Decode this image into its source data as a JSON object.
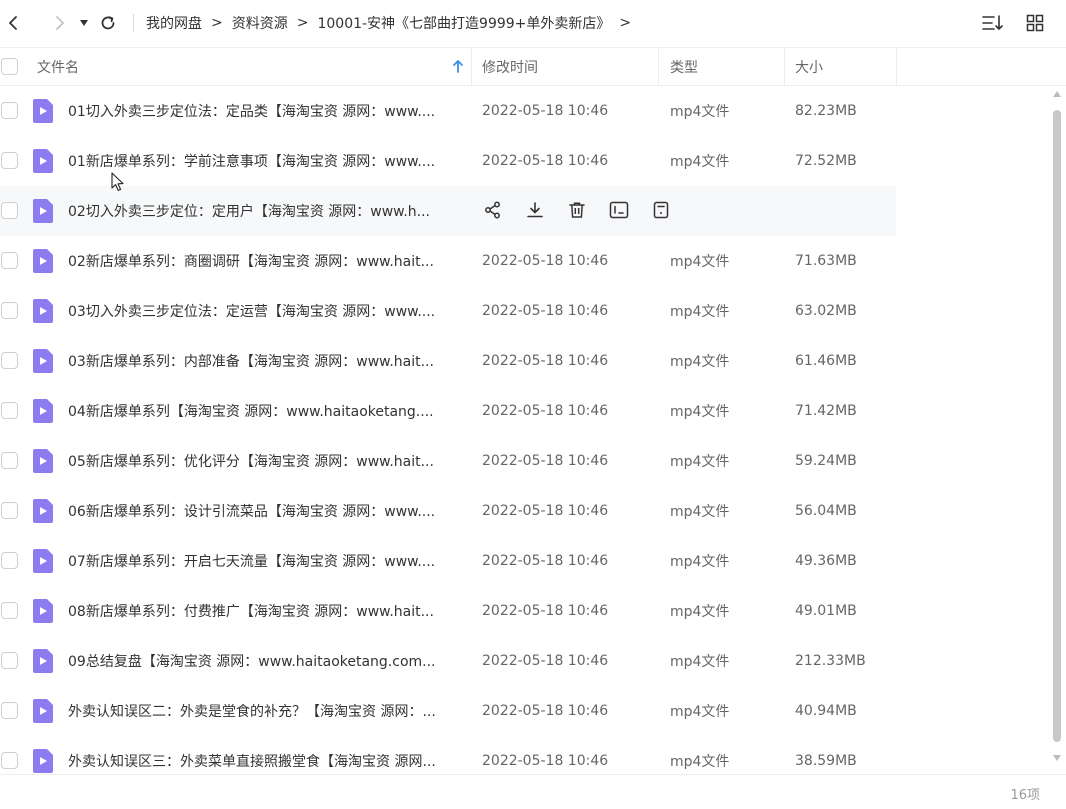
{
  "toolbar": {
    "breadcrumb": [
      "我的网盘",
      "资料资源",
      "10001-安神《七部曲打造9999+单外卖新店》"
    ],
    "separator": ">",
    "icons": {
      "back": "chevron-left-icon",
      "forward": "chevron-right-icon",
      "dropdown": "triangle-down-icon",
      "refresh": "refresh-icon",
      "sort": "sort-list-icon",
      "grid": "grid-view-icon"
    }
  },
  "header": {
    "name": "文件名",
    "time": "修改时间",
    "type": "类型",
    "size": "大小"
  },
  "files": [
    {
      "name": "01切入外卖三步定位法：定品类【海淘宝资 源网：www....",
      "time": "2022-05-18 10:46",
      "type": "mp4文件",
      "size": "82.23MB"
    },
    {
      "name": "01新店爆单系列：学前注意事项【海淘宝资 源网：www....",
      "time": "2022-05-18 10:46",
      "type": "mp4文件",
      "size": "72.52MB"
    },
    {
      "name": "02切入外卖三步定位：定用户【海淘宝资 源网：www.h...",
      "time": "",
      "type": "",
      "size": "",
      "hovered": true
    },
    {
      "name": "02新店爆单系列：商圈调研【海淘宝资 源网：www.hait...",
      "time": "2022-05-18 10:46",
      "type": "mp4文件",
      "size": "71.63MB"
    },
    {
      "name": "03切入外卖三步定位法：定运营【海淘宝资 源网：www....",
      "time": "2022-05-18 10:46",
      "type": "mp4文件",
      "size": "63.02MB"
    },
    {
      "name": "03新店爆单系列：内部准备【海淘宝资 源网：www.hait...",
      "time": "2022-05-18 10:46",
      "type": "mp4文件",
      "size": "61.46MB"
    },
    {
      "name": "04新店爆单系列【海淘宝资 源网：www.haitaoketang....",
      "time": "2022-05-18 10:46",
      "type": "mp4文件",
      "size": "71.42MB"
    },
    {
      "name": "05新店爆单系列：优化评分【海淘宝资 源网：www.hait...",
      "time": "2022-05-18 10:46",
      "type": "mp4文件",
      "size": "59.24MB"
    },
    {
      "name": "06新店爆单系列：设计引流菜品【海淘宝资 源网：www....",
      "time": "2022-05-18 10:46",
      "type": "mp4文件",
      "size": "56.04MB"
    },
    {
      "name": "07新店爆单系列：开启七天流量【海淘宝资 源网：www....",
      "time": "2022-05-18 10:46",
      "type": "mp4文件",
      "size": "49.36MB"
    },
    {
      "name": "08新店爆单系列：付费推广【海淘宝资 源网：www.hait...",
      "time": "2022-05-18 10:46",
      "type": "mp4文件",
      "size": "49.01MB"
    },
    {
      "name": "09总结复盘【海淘宝资 源网：www.haitaoketang.com...",
      "time": "2022-05-18 10:46",
      "type": "mp4文件",
      "size": "212.33MB"
    },
    {
      "name": "外卖认知误区二：外卖是堂食的补充？【海淘宝资 源网：...",
      "time": "2022-05-18 10:46",
      "type": "mp4文件",
      "size": "40.94MB"
    },
    {
      "name": "外卖认知误区三：外卖菜单直接照搬堂食【海淘宝资 源网...",
      "time": "2022-05-18 10:46",
      "type": "mp4文件",
      "size": "38.59MB"
    }
  ],
  "row_actions": [
    "share-icon",
    "download-icon",
    "delete-icon",
    "rename-icon",
    "more-icon"
  ],
  "footer": {
    "count": "16项"
  },
  "colors": {
    "file_icon": "#8c7cf0",
    "hover_row": "#f7f8fa",
    "sort_arrow": "#3a8ee6"
  }
}
